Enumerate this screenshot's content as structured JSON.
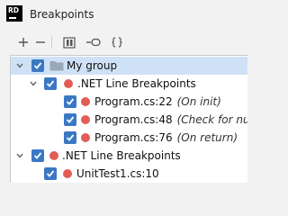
{
  "window": {
    "title": "Breakpoints",
    "app_icon_text": "RD",
    "app_icon_color": "#000000"
  },
  "toolbar": {
    "buttons": [
      {
        "name": "add-icon",
        "tooltip": "Add"
      },
      {
        "name": "remove-icon",
        "tooltip": "Remove"
      },
      {
        "name": "group-icon",
        "tooltip": "Group"
      },
      {
        "name": "toggle-icon",
        "tooltip": "Toggle"
      },
      {
        "name": "braces-icon",
        "tooltip": "Condition"
      }
    ]
  },
  "tree": {
    "selection_color": "#cfe1f7",
    "checkbox_color": "#3b78c4",
    "breakpoint_color": "#e25d55",
    "rows": [
      {
        "label": "My group",
        "note": "",
        "type": "group",
        "expanded": true,
        "checked": true,
        "selected": true
      },
      {
        "label": ".NET Line Breakpoints",
        "note": "",
        "type": "category",
        "expanded": true,
        "checked": true,
        "selected": false
      },
      {
        "label": "Program.cs:22",
        "note": "(On init)",
        "type": "breakpoint",
        "checked": true,
        "selected": false
      },
      {
        "label": "Program.cs:48",
        "note": "(Check for null)",
        "type": "breakpoint",
        "checked": true,
        "selected": false
      },
      {
        "label": "Program.cs:76",
        "note": "(On return)",
        "type": "breakpoint",
        "checked": true,
        "selected": false
      },
      {
        "label": ".NET Line Breakpoints",
        "note": "",
        "type": "category",
        "expanded": true,
        "checked": true,
        "selected": false
      },
      {
        "label": "UnitTest1.cs:10",
        "note": "",
        "type": "breakpoint",
        "checked": true,
        "selected": false
      }
    ]
  }
}
